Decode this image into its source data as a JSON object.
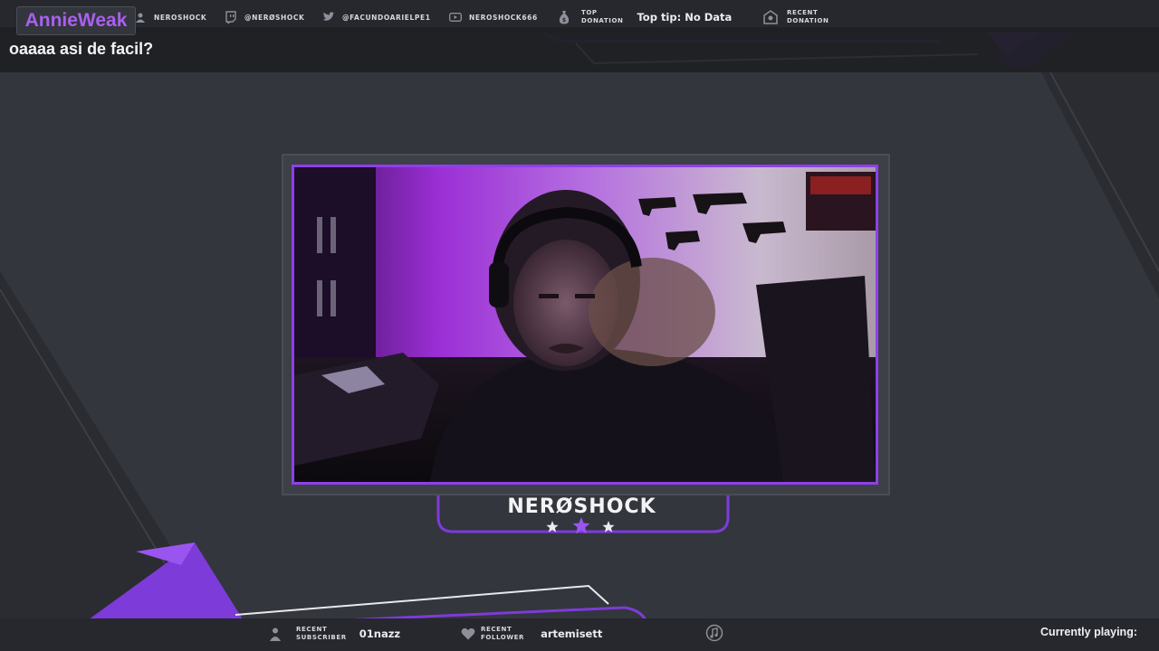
{
  "chat": {
    "username": "AnnieWeak",
    "message": "oaaaa asi de facil?"
  },
  "topbar": {
    "socials": [
      {
        "icon": "user-icon",
        "handle": "NEROSHOCK"
      },
      {
        "icon": "twitch-icon",
        "handle": "@NERØSHOCK"
      },
      {
        "icon": "twitter-icon",
        "handle": "@FACUNDOARIELPE1"
      },
      {
        "icon": "youtube-icon",
        "handle": "NEROSHOCK666"
      }
    ],
    "top_donation": {
      "label_line1": "TOP",
      "label_line2": "DONATION",
      "value": "Top tip: No Data"
    },
    "recent_donation": {
      "label_line1": "RECENT",
      "label_line2": "DONATION",
      "value": ""
    }
  },
  "channel": {
    "name": "NERØSHOCK"
  },
  "bottombar": {
    "recent_subscriber": {
      "label_line1": "RECENT",
      "label_line2": "SUBSCRIBER",
      "value": "01nazz"
    },
    "recent_follower": {
      "label_line1": "RECENT",
      "label_line2": "FOLLOWER",
      "value": "artemisett"
    },
    "music_icon": "music-icon",
    "currently_playing": "Currently playing:"
  },
  "colors": {
    "accent": "#8f3fe8",
    "chat_name": "#a960ef",
    "background": "#2f3238",
    "bar": "#26282d"
  }
}
